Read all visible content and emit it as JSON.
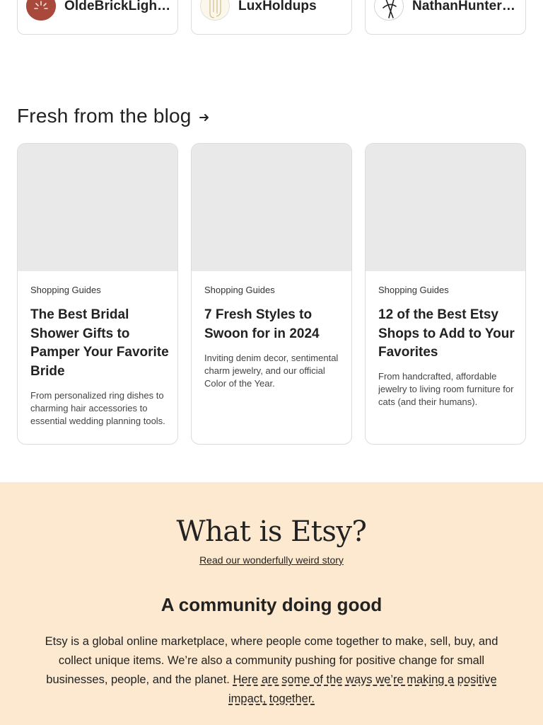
{
  "shops": [
    {
      "name": "OldeBrickLighti...",
      "avatar_color": "#a8493b",
      "icon": "shop-logo-icon"
    },
    {
      "name": "LuxHoldups",
      "avatar_color": "#fbf7ea",
      "icon": "shop-logo-icon"
    },
    {
      "name": "NathanHunterD...",
      "avatar_color": "#ffffff",
      "icon": "shop-logo-icon"
    }
  ],
  "blog": {
    "heading": "Fresh from the blog",
    "arrow_icon": "arrow-right-icon",
    "cards": [
      {
        "category": "Shopping Guides",
        "title": "The Best Bridal Shower Gifts to Pamper Your Favorite Bride",
        "excerpt": "From personalized ring dishes to charming hair accessories to essential wedding planning tools."
      },
      {
        "category": "Shopping Guides",
        "title": "7 Fresh Styles to Swoon for in 2024",
        "excerpt": "Inviting denim decor, sentimental charm jewelry, and our official Color of the Year."
      },
      {
        "category": "Shopping Guides",
        "title": "12 of the Best Etsy Shops to Add to Your Favorites",
        "excerpt": "From handcrafted, affordable jewelry to living room furniture for cats (and their humans)."
      }
    ]
  },
  "what_is_etsy": {
    "title": "What is Etsy?",
    "story_link": "Read our wonderfully weird story",
    "community_heading": "A community doing good",
    "community_text": "Etsy is a global online marketplace, where people come together to make, sell, buy, and collect unique items. We’re also a community pushing for positive change for small businesses, people, and the planet.",
    "impact_link": "Here are some of the ways we’re making a positive impact, together.",
    "background": "#fce9cf"
  }
}
